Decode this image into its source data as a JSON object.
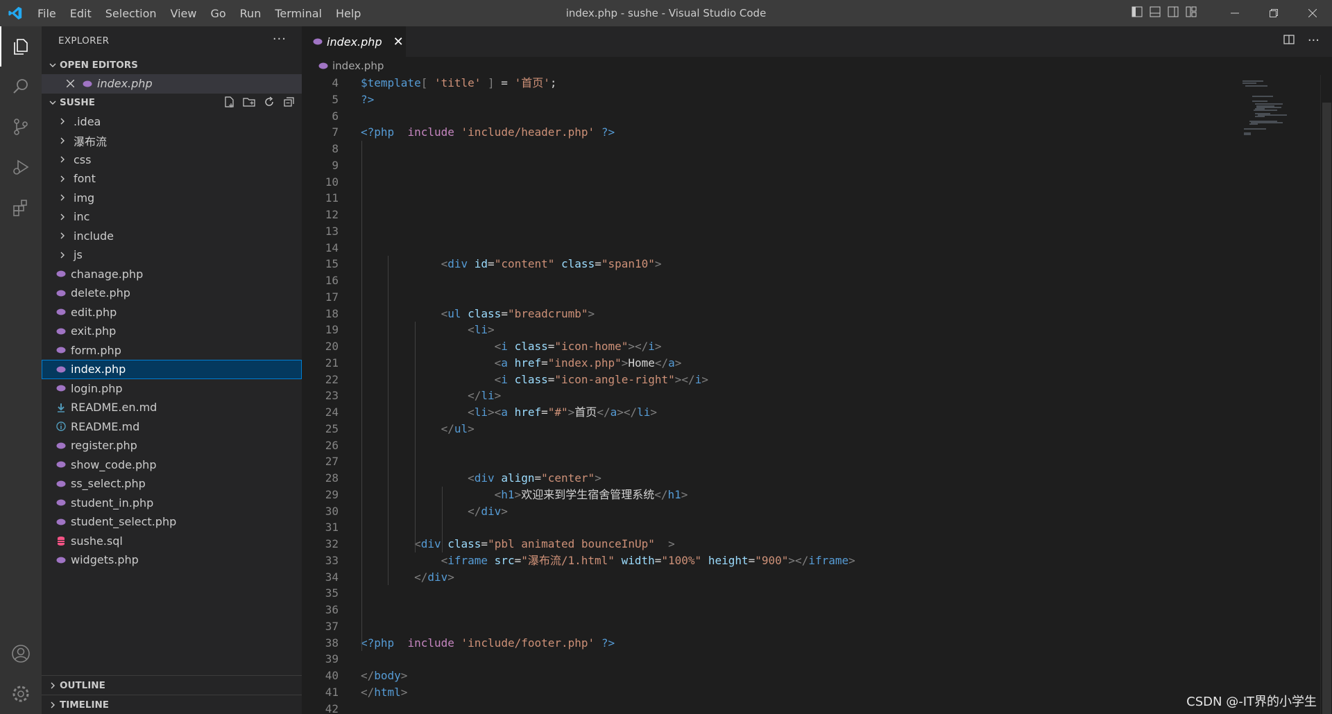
{
  "titlebar": {
    "menu": [
      "File",
      "Edit",
      "Selection",
      "View",
      "Go",
      "Run",
      "Terminal",
      "Help"
    ],
    "title": "index.php - sushe - Visual Studio Code"
  },
  "activity_bar": {
    "items": [
      "files-icon",
      "search-icon",
      "source-control-icon",
      "run-debug-icon",
      "extensions-icon"
    ],
    "bottom": [
      "account-icon",
      "settings-gear-icon"
    ]
  },
  "sidebar": {
    "header": "EXPLORER",
    "open_editors_label": "OPEN EDITORS",
    "open_editor_file": "index.php",
    "project_label": "SUSHE",
    "folders": [
      ".idea",
      "瀑布流",
      "css",
      "font",
      "img",
      "inc",
      "include",
      "js"
    ],
    "files": [
      {
        "name": "chanage.php",
        "icon": "php"
      },
      {
        "name": "delete.php",
        "icon": "php"
      },
      {
        "name": "edit.php",
        "icon": "php"
      },
      {
        "name": "exit.php",
        "icon": "php"
      },
      {
        "name": "form.php",
        "icon": "php"
      },
      {
        "name": "index.php",
        "icon": "php",
        "selected": true
      },
      {
        "name": "login.php",
        "icon": "php"
      },
      {
        "name": "README.en.md",
        "icon": "download"
      },
      {
        "name": "README.md",
        "icon": "info"
      },
      {
        "name": "register.php",
        "icon": "php"
      },
      {
        "name": "show_code.php",
        "icon": "php"
      },
      {
        "name": "ss_select.php",
        "icon": "php"
      },
      {
        "name": "student_in.php",
        "icon": "php"
      },
      {
        "name": "student_select.php",
        "icon": "php"
      },
      {
        "name": "sushe.sql",
        "icon": "database"
      },
      {
        "name": "widgets.php",
        "icon": "php"
      }
    ],
    "outline_label": "OUTLINE",
    "timeline_label": "TIMELINE"
  },
  "editor": {
    "tab_label": "index.php",
    "breadcrumb": "index.php",
    "lines": [
      {
        "n": "4",
        "tokens": [
          [
            "php",
            "$template"
          ],
          [
            "br",
            "[ "
          ],
          [
            "str",
            "'title'"
          ],
          [
            "br",
            " ]"
          ],
          [
            "txt",
            " = "
          ],
          [
            "str",
            "'首页'"
          ],
          [
            "txt",
            ";"
          ]
        ]
      },
      {
        "n": "5",
        "tokens": [
          [
            "php",
            "?>"
          ]
        ]
      },
      {
        "n": "6",
        "tokens": []
      },
      {
        "n": "7",
        "tokens": [
          [
            "php",
            "<?php"
          ],
          [
            "txt",
            "  "
          ],
          [
            "kw",
            "include"
          ],
          [
            "txt",
            " "
          ],
          [
            "str",
            "'include/header.php'"
          ],
          [
            "txt",
            " "
          ],
          [
            "php",
            "?>"
          ]
        ]
      },
      {
        "n": "8",
        "tokens": []
      },
      {
        "n": "9",
        "tokens": []
      },
      {
        "n": "10",
        "tokens": []
      },
      {
        "n": "11",
        "tokens": []
      },
      {
        "n": "12",
        "tokens": []
      },
      {
        "n": "13",
        "tokens": []
      },
      {
        "n": "14",
        "tokens": []
      },
      {
        "n": "15",
        "tokens": [
          [
            "txt",
            "            "
          ],
          [
            "br",
            "<"
          ],
          [
            "tag",
            "div"
          ],
          [
            "txt",
            " "
          ],
          [
            "attr",
            "id"
          ],
          [
            "txt",
            "="
          ],
          [
            "str",
            "\"content\""
          ],
          [
            "txt",
            " "
          ],
          [
            "attr",
            "class"
          ],
          [
            "txt",
            "="
          ],
          [
            "str",
            "\"span10\""
          ],
          [
            "br",
            ">"
          ]
        ]
      },
      {
        "n": "16",
        "tokens": []
      },
      {
        "n": "17",
        "tokens": []
      },
      {
        "n": "18",
        "tokens": [
          [
            "txt",
            "            "
          ],
          [
            "br",
            "<"
          ],
          [
            "tag",
            "ul"
          ],
          [
            "txt",
            " "
          ],
          [
            "attr",
            "class"
          ],
          [
            "txt",
            "="
          ],
          [
            "str",
            "\"breadcrumb\""
          ],
          [
            "br",
            ">"
          ]
        ]
      },
      {
        "n": "19",
        "tokens": [
          [
            "txt",
            "                "
          ],
          [
            "br",
            "<"
          ],
          [
            "tag",
            "li"
          ],
          [
            "br",
            ">"
          ]
        ]
      },
      {
        "n": "20",
        "tokens": [
          [
            "txt",
            "                    "
          ],
          [
            "br",
            "<"
          ],
          [
            "tag",
            "i"
          ],
          [
            "txt",
            " "
          ],
          [
            "attr",
            "class"
          ],
          [
            "txt",
            "="
          ],
          [
            "str",
            "\"icon-home\""
          ],
          [
            "br",
            "></"
          ],
          [
            "tag",
            "i"
          ],
          [
            "br",
            ">"
          ]
        ]
      },
      {
        "n": "21",
        "tokens": [
          [
            "txt",
            "                    "
          ],
          [
            "br",
            "<"
          ],
          [
            "tag",
            "a"
          ],
          [
            "txt",
            " "
          ],
          [
            "attr",
            "href"
          ],
          [
            "txt",
            "="
          ],
          [
            "str",
            "\"index.php\""
          ],
          [
            "br",
            ">"
          ],
          [
            "txt",
            "Home"
          ],
          [
            "br",
            "</"
          ],
          [
            "tag",
            "a"
          ],
          [
            "br",
            ">"
          ]
        ]
      },
      {
        "n": "22",
        "tokens": [
          [
            "txt",
            "                    "
          ],
          [
            "br",
            "<"
          ],
          [
            "tag",
            "i"
          ],
          [
            "txt",
            " "
          ],
          [
            "attr",
            "class"
          ],
          [
            "txt",
            "="
          ],
          [
            "str",
            "\"icon-angle-right\""
          ],
          [
            "br",
            "></"
          ],
          [
            "tag",
            "i"
          ],
          [
            "br",
            ">"
          ]
        ]
      },
      {
        "n": "23",
        "tokens": [
          [
            "txt",
            "                "
          ],
          [
            "br",
            "</"
          ],
          [
            "tag",
            "li"
          ],
          [
            "br",
            ">"
          ]
        ]
      },
      {
        "n": "24",
        "tokens": [
          [
            "txt",
            "                "
          ],
          [
            "br",
            "<"
          ],
          [
            "tag",
            "li"
          ],
          [
            "br",
            "><"
          ],
          [
            "tag",
            "a"
          ],
          [
            "txt",
            " "
          ],
          [
            "attr",
            "href"
          ],
          [
            "txt",
            "="
          ],
          [
            "str",
            "\"#\""
          ],
          [
            "br",
            ">"
          ],
          [
            "txt",
            "首页"
          ],
          [
            "br",
            "</"
          ],
          [
            "tag",
            "a"
          ],
          [
            "br",
            "></"
          ],
          [
            "tag",
            "li"
          ],
          [
            "br",
            ">"
          ]
        ]
      },
      {
        "n": "25",
        "tokens": [
          [
            "txt",
            "            "
          ],
          [
            "br",
            "</"
          ],
          [
            "tag",
            "ul"
          ],
          [
            "br",
            ">"
          ]
        ]
      },
      {
        "n": "26",
        "tokens": []
      },
      {
        "n": "27",
        "tokens": []
      },
      {
        "n": "28",
        "tokens": [
          [
            "txt",
            "                "
          ],
          [
            "br",
            "<"
          ],
          [
            "tag",
            "div"
          ],
          [
            "txt",
            " "
          ],
          [
            "attr",
            "align"
          ],
          [
            "txt",
            "="
          ],
          [
            "str",
            "\"center\""
          ],
          [
            "br",
            ">"
          ]
        ]
      },
      {
        "n": "29",
        "tokens": [
          [
            "txt",
            "                    "
          ],
          [
            "br",
            "<"
          ],
          [
            "tag",
            "h1"
          ],
          [
            "br",
            ">"
          ],
          [
            "txt",
            "欢迎来到学生宿舍管理系统"
          ],
          [
            "br",
            "</"
          ],
          [
            "tag",
            "h1"
          ],
          [
            "br",
            ">"
          ]
        ]
      },
      {
        "n": "30",
        "tokens": [
          [
            "txt",
            "                "
          ],
          [
            "br",
            "</"
          ],
          [
            "tag",
            "div"
          ],
          [
            "br",
            ">"
          ]
        ]
      },
      {
        "n": "31",
        "tokens": []
      },
      {
        "n": "32",
        "tokens": [
          [
            "txt",
            "        "
          ],
          [
            "br",
            "<"
          ],
          [
            "tag",
            "div"
          ],
          [
            "txt",
            " "
          ],
          [
            "attr",
            "class"
          ],
          [
            "txt",
            "="
          ],
          [
            "str",
            "\"pbl animated bounceInUp\""
          ],
          [
            "txt",
            "  "
          ],
          [
            "br",
            ">"
          ]
        ]
      },
      {
        "n": "33",
        "tokens": [
          [
            "txt",
            "            "
          ],
          [
            "br",
            "<"
          ],
          [
            "tag",
            "iframe"
          ],
          [
            "txt",
            " "
          ],
          [
            "attr",
            "src"
          ],
          [
            "txt",
            "="
          ],
          [
            "str",
            "\"瀑布流/1.html\""
          ],
          [
            "txt",
            " "
          ],
          [
            "attr",
            "width"
          ],
          [
            "txt",
            "="
          ],
          [
            "str",
            "\"100%\""
          ],
          [
            "txt",
            " "
          ],
          [
            "attr",
            "height"
          ],
          [
            "txt",
            "="
          ],
          [
            "str",
            "\"900\""
          ],
          [
            "br",
            "></"
          ],
          [
            "tag",
            "iframe"
          ],
          [
            "br",
            ">"
          ]
        ]
      },
      {
        "n": "34",
        "tokens": [
          [
            "txt",
            "        "
          ],
          [
            "br",
            "</"
          ],
          [
            "tag",
            "div"
          ],
          [
            "br",
            ">"
          ]
        ]
      },
      {
        "n": "35",
        "tokens": []
      },
      {
        "n": "36",
        "tokens": []
      },
      {
        "n": "37",
        "tokens": []
      },
      {
        "n": "38",
        "tokens": [
          [
            "php",
            "<?php"
          ],
          [
            "txt",
            "  "
          ],
          [
            "kw",
            "include"
          ],
          [
            "txt",
            " "
          ],
          [
            "str",
            "'include/footer.php'"
          ],
          [
            "txt",
            " "
          ],
          [
            "php",
            "?>"
          ]
        ]
      },
      {
        "n": "39",
        "tokens": []
      },
      {
        "n": "40",
        "tokens": [
          [
            "br",
            "</"
          ],
          [
            "tag",
            "body"
          ],
          [
            "br",
            ">"
          ]
        ]
      },
      {
        "n": "41",
        "tokens": [
          [
            "br",
            "</"
          ],
          [
            "tag",
            "html"
          ],
          [
            "br",
            ">"
          ]
        ]
      },
      {
        "n": "42",
        "tokens": []
      }
    ]
  },
  "watermark": "CSDN @-IT界的小学生",
  "colors": {
    "titlebar": "#3c3c3c",
    "activitybar": "#333333",
    "sidebar": "#252526",
    "editor": "#1e1e1e",
    "selection": "#04395e",
    "php_icon": "#a074c4"
  }
}
